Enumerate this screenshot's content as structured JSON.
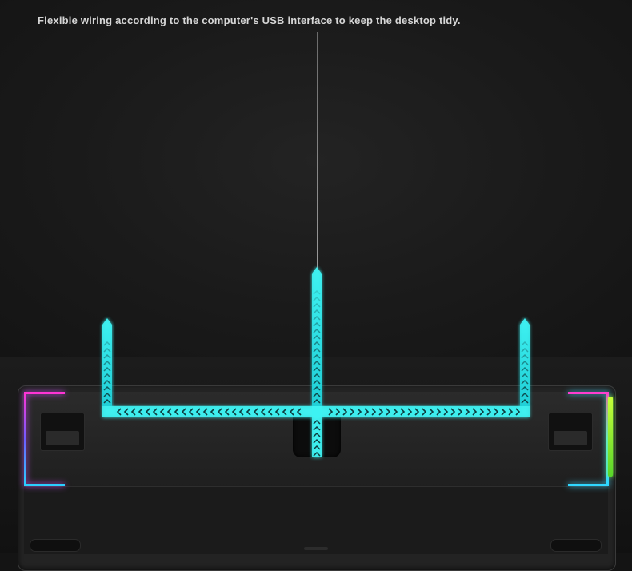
{
  "caption": "Flexible wiring according to the computer's USB interface to keep the desktop tidy.",
  "colors": {
    "background": "#141414",
    "caption_text": "#d6d6d6",
    "arrow_cyan": "#3ff2f2",
    "rgb_magenta": "#ff34d4",
    "rgb_blue": "#2ad0ff",
    "rgb_green": "#8aff3a"
  },
  "icons": {
    "route_arrows": "chevron-arrow-icon"
  }
}
